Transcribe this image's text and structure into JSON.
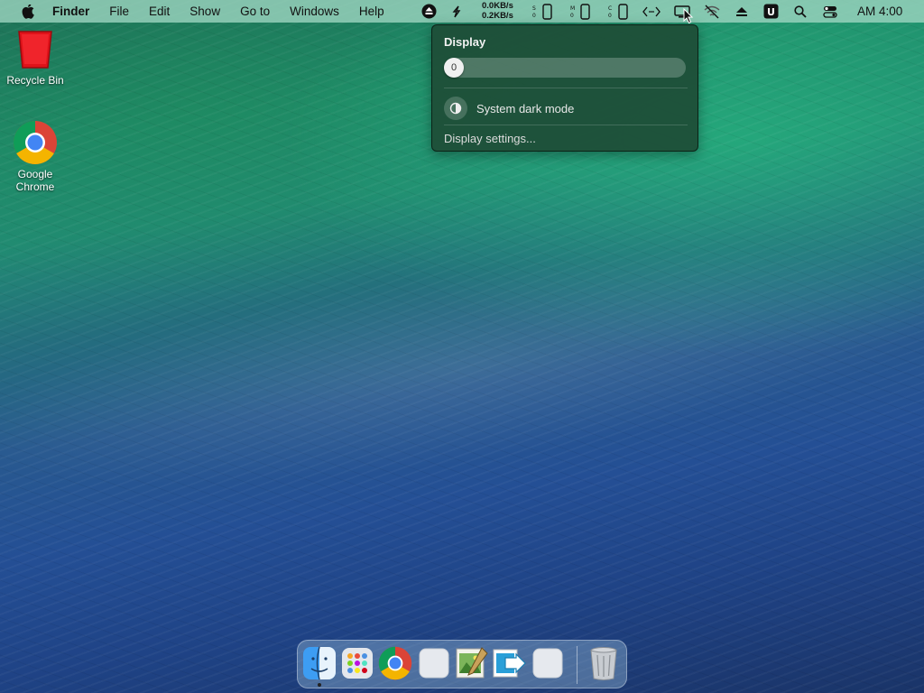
{
  "menubar": {
    "app_name": "Finder",
    "menus": [
      "File",
      "Edit",
      "Show",
      "Go to",
      "Windows",
      "Help"
    ],
    "network": {
      "down": "0.0KB/s",
      "up": "0.2KB/s"
    },
    "clock": "AM 4:00",
    "status_icons": [
      "eject-circle-icon",
      "sync-icon",
      "net-speed",
      "battery-s-icon",
      "battery-m-icon",
      "battery-c-icon",
      "code-icon",
      "display-icon",
      "wifi-off-icon",
      "eject-icon",
      "u-app-icon",
      "search-icon",
      "control-center-icon"
    ]
  },
  "desktop": {
    "icons": [
      {
        "label": "Recycle Bin",
        "icon": "recycle-bin-icon"
      },
      {
        "label": "Google Chrome",
        "icon": "chrome-icon"
      }
    ]
  },
  "display_popup": {
    "title": "Display",
    "brightness_value": "0",
    "brightness_level": 0,
    "dark_mode_label": "System dark mode",
    "settings_link": "Display settings..."
  },
  "dock": {
    "items": [
      "finder-icon",
      "launchpad-icon",
      "chrome-icon",
      "blank-app-icon",
      "image-viewer-icon",
      "migration-icon",
      "blank-app-icon",
      "trash-icon"
    ]
  },
  "colors": {
    "menubar": "#a0d7c3",
    "popup_bg": "#1e4e37",
    "accent": "#ffffff"
  }
}
